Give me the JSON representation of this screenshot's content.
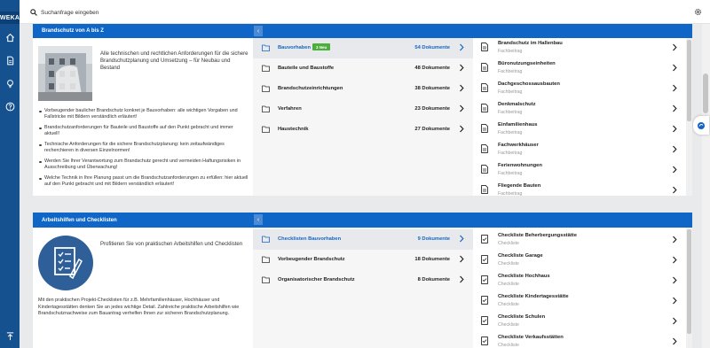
{
  "brand": {
    "logo_text": "WEKA"
  },
  "colors": {
    "accent": "#0f66c6",
    "rail": "#15508f",
    "badge": "#4cae3b"
  },
  "search": {
    "placeholder": "Suchanfrage eingeben",
    "value": ""
  },
  "rail_icons": [
    "home-icon",
    "document-icon",
    "lightbulb-icon",
    "help-icon",
    "scroll-to-top-icon"
  ],
  "section1": {
    "title": "Brandschutz von A bis Z",
    "promo": "Alle technischen und rechtlichen Anforderungen für die sichere Brandschutzplanung und Umsetzung – für Neubau und Bestand",
    "bullets": [
      "Vorbeugender baulicher Brandschutz konkret je Bauvorhaben: alle wichtigen Vorgaben und Fallstricke mit Bildern verständlich erläutert!",
      "Brandschutzanforderungen für Bauteile und Baustoffe auf den Punkt gebracht und immer aktuell!",
      "Technische Anforderungen für die sichere Brandschutzplanung: kein zeitaufwändiges recherchieren in diversen Einzelnormen!",
      "Werden Sie Ihrer Verantwortung zum Brandschutz gerecht und vermeiden Haftungsrisiken in Ausschreibung und Überwachung!",
      "Welche Technik in Ihre Planung passt um die Brandschutzanforderungen zu erfüllen: hier aktuell auf den Punkt gebracht und mit Bildern verständlich erläutert!"
    ],
    "categories": [
      {
        "label": "Bauvorhaben",
        "badge": "3 Neu",
        "count": "54 Dokumente"
      },
      {
        "label": "Bauteile und Baustoffe",
        "count": "48 Dokumente"
      },
      {
        "label": "Brandschutzeinrichtungen",
        "count": "38 Dokumente"
      },
      {
        "label": "Verfahren",
        "count": "23 Dokumente"
      },
      {
        "label": "Haustechnik",
        "count": "27 Dokumente"
      }
    ],
    "documents": [
      {
        "title": "Brandschutz im Hallenbau",
        "type": "Fachbeitrag"
      },
      {
        "title": "Büronutzungseinheiten",
        "type": "Fachbeitrag"
      },
      {
        "title": "Dachgeschossausbauten",
        "type": "Fachbeitrag"
      },
      {
        "title": "Denkmalschutz",
        "type": "Fachbeitrag"
      },
      {
        "title": "Einfamilienhaus",
        "type": "Fachbeitrag"
      },
      {
        "title": "Fachwerkhäuser",
        "type": "Fachbeitrag"
      },
      {
        "title": "Ferienwohnungen",
        "type": "Fachbeitrag"
      },
      {
        "title": "Fliegende Bauten",
        "type": "Fachbeitrag"
      }
    ]
  },
  "section2": {
    "title": "Arbeitshilfen und Checklisten",
    "promo": "Profitieren Sie von praktischen Arbeitshilfen und Checklisten",
    "body": "Mit den praktischen Projekt-Checklisten für z.B. Mehrfamilienhäuser, Hochhäuser und Kindertagesstätten denken Sie an jedes wichtige Detail. Zahlreiche praktische Arbeitshilfen wie Brandschutznachweise zum Bauantrag verhelfen Ihnen zur sicheren Brandschutzplanung.",
    "categories": [
      {
        "label": "Checklisten Bauvorhaben",
        "count": "9 Dokumente"
      },
      {
        "label": "Vorbeugender Brandschutz",
        "count": "18 Dokumente"
      },
      {
        "label": "Organisatorischer Brandschutz",
        "count": "8 Dokumente"
      }
    ],
    "documents": [
      {
        "title": "Checkliste Beherbergungsstätte",
        "type": "Checkliste"
      },
      {
        "title": "Checkliste Garage",
        "type": "Checkliste"
      },
      {
        "title": "Checkliste Hochhaus",
        "type": "Checkliste"
      },
      {
        "title": "Checkliste Kindertagesstätte",
        "type": "Checkliste"
      },
      {
        "title": "Checkliste Schulen",
        "type": "Checkliste"
      },
      {
        "title": "Checkliste Verkaufsstätten",
        "type": "Checkliste"
      }
    ]
  }
}
